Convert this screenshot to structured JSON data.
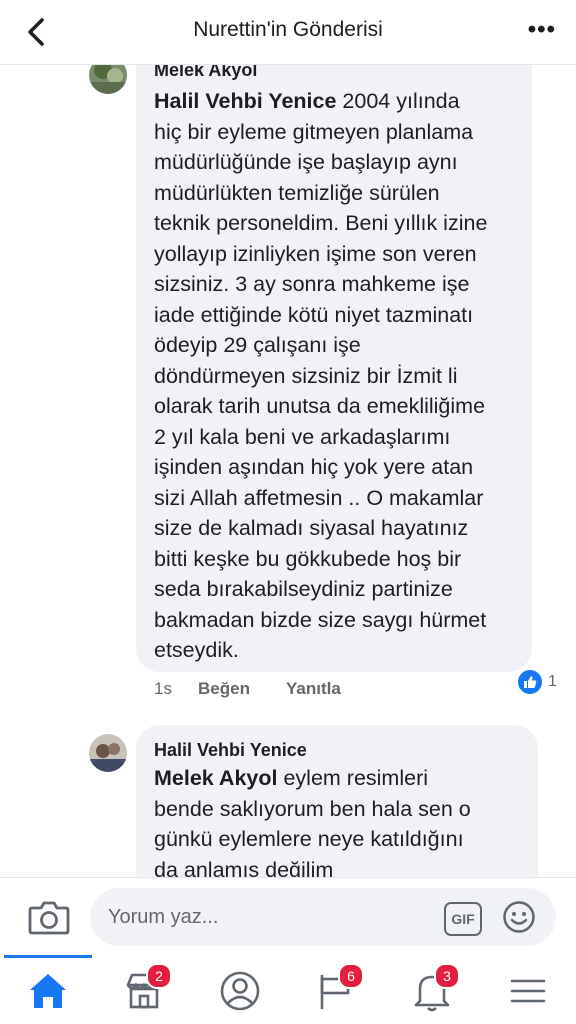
{
  "header": {
    "title": "Nurettin'in Gönderisi"
  },
  "comment1": {
    "author": "Melek Akyol",
    "mention": "Halil Vehbi Yenice",
    "lines": [
      " 2004 yılında",
      "hiç bir eyleme gitmeyen planlama",
      "müdürlüğünde işe başlayıp aynı",
      "müdürlükten temizliğe sürülen",
      "teknik personeldim. Beni yıllık izine",
      "yollayıp izinliyken işime son veren",
      "sizsiniz. 3 ay sonra mahkeme işe",
      "iade ettiğinde kötü niyet tazminatı",
      "ödeyip 29 çalışanı işe",
      "döndürmeyen sizsiniz  bir İzmit li",
      "olarak tarih unutsa da emekliliğime",
      "2 yıl kala beni ve arkadaşlarımı",
      "işinden aşından hiç yok yere atan",
      "sizi Allah affetmesin .. O makamlar",
      "size de kalmadı siyasal hayatınız",
      "bitti keşke bu gökkubede hoş bir",
      "seda bırakabilseydiniz partinize",
      "bakmadan bizde size saygı hürmet",
      "etseydik."
    ],
    "time": "1s",
    "like_label": "Beğen",
    "reply_label": "Yanıtla",
    "reaction_count": "1"
  },
  "comment2": {
    "author": "Halil Vehbi Yenice",
    "mention": "Melek Akyol",
    "lines": [
      " eylem resimleri",
      "bende saklıyorum ben hala sen o",
      "günkü eylemlere neye katıldığını",
      "da anlamış değilim"
    ]
  },
  "composer": {
    "placeholder": "Yorum yaz...",
    "gif_label": "GIF"
  },
  "tabs": {
    "marketplace_badge": "2",
    "feed_badge": "6",
    "notifications_badge": "3"
  },
  "colors": {
    "accent": "#1877f2",
    "badge": "#e41e3f",
    "bubble": "#f0f2f5"
  }
}
